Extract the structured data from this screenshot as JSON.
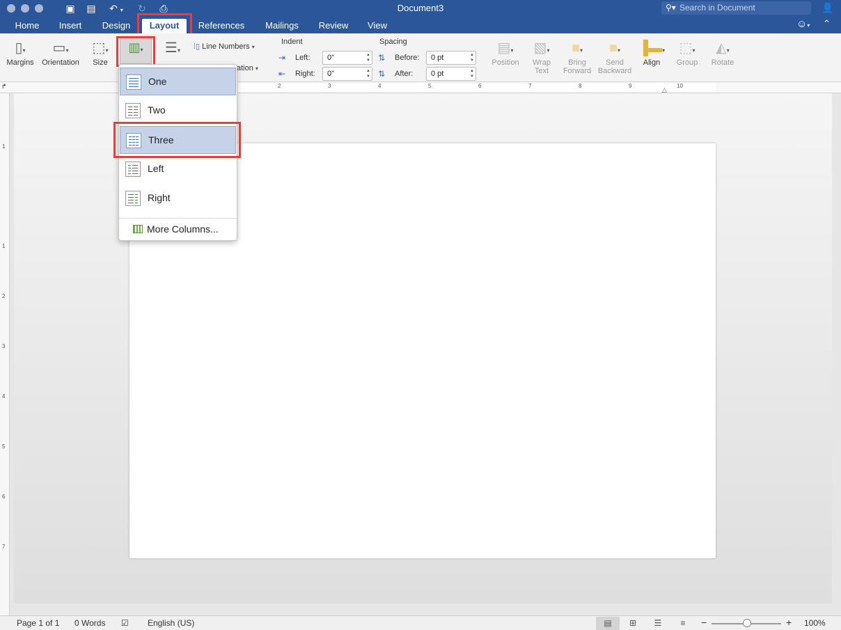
{
  "window": {
    "title": "Document3",
    "search_placeholder": "Search in Document"
  },
  "tabs": [
    {
      "label": "Home"
    },
    {
      "label": "Insert"
    },
    {
      "label": "Design"
    },
    {
      "label": "Layout"
    },
    {
      "label": "References"
    },
    {
      "label": "Mailings"
    },
    {
      "label": "Review"
    },
    {
      "label": "View"
    }
  ],
  "active_tab": "Layout",
  "ribbon": {
    "margins": "Margins",
    "orientation": "Orientation",
    "size": "Size",
    "line_numbers": "Line Numbers",
    "hyphenation_partial": "ation",
    "indent": {
      "label": "Indent",
      "left_label": "Left:",
      "left_value": "0\"",
      "right_label": "Right:",
      "right_value": "0\""
    },
    "spacing": {
      "label": "Spacing",
      "before_label": "Before:",
      "before_value": "0 pt",
      "after_label": "After:",
      "after_value": "0 pt"
    },
    "position": "Position",
    "wrap_text_1": "Wrap",
    "wrap_text_2": "Text",
    "bring_forward_1": "Bring",
    "bring_forward_2": "Forward",
    "send_backward_1": "Send",
    "send_backward_2": "Backward",
    "align": "Align",
    "group": "Group",
    "rotate": "Rotate"
  },
  "ruler": {
    "numbers": [
      "2",
      "3",
      "4",
      "5",
      "6",
      "7",
      "8",
      "9",
      "10"
    ],
    "vnumbers": [
      "1",
      "1",
      "2",
      "3",
      "4",
      "5",
      "6",
      "7"
    ]
  },
  "columns_menu": {
    "items": [
      {
        "label": "One",
        "lines": 1
      },
      {
        "label": "Two",
        "lines": 2
      },
      {
        "label": "Three",
        "lines": 3
      },
      {
        "label": "Left",
        "lines": 2
      },
      {
        "label": "Right",
        "lines": 2
      }
    ],
    "selected": "One",
    "highlighted": "Three",
    "more": "More Columns..."
  },
  "status": {
    "page": "Page 1 of 1",
    "words": "0 Words",
    "language": "English (US)",
    "zoom": "100%",
    "zoom_minus": "−",
    "zoom_plus": "+"
  },
  "colors": {
    "accent": "#2b579a",
    "highlight": "#ee3b3b",
    "selected_item": "#c5d2e7"
  }
}
